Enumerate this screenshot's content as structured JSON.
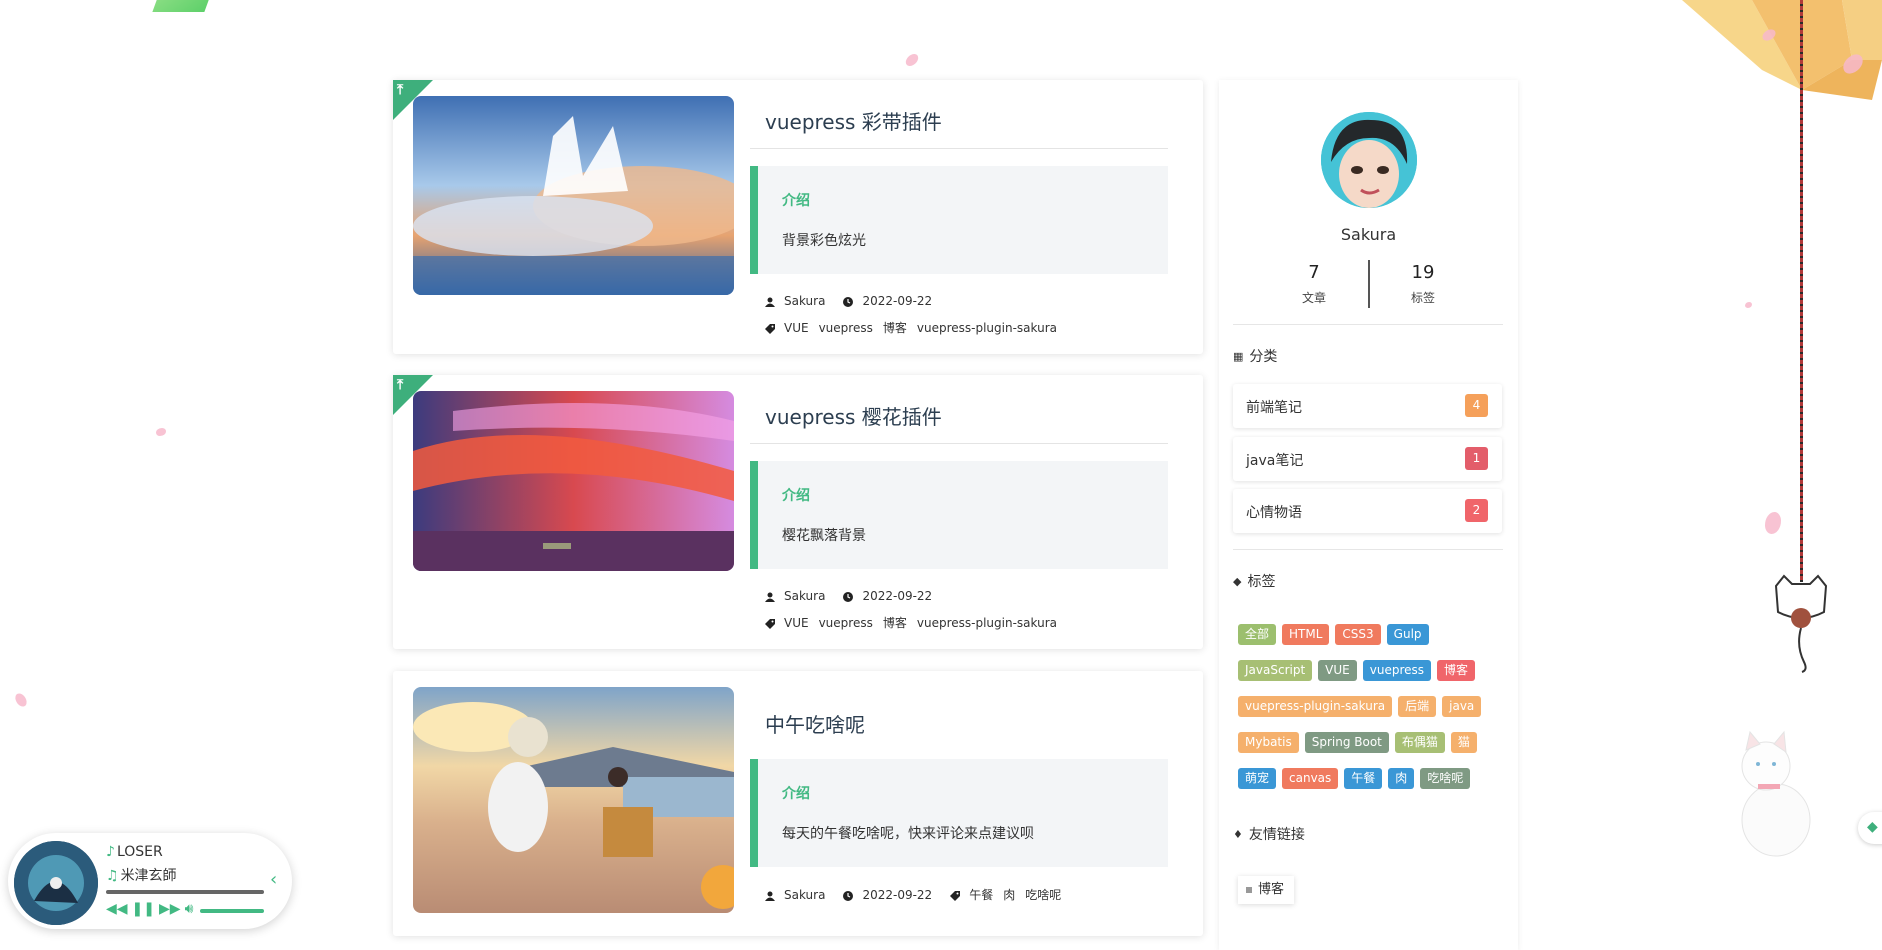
{
  "posts": [
    {
      "title": "vuepress 彩带插件",
      "excerpt_heading": "介绍",
      "excerpt_text": "背景彩色炫光",
      "author": "Sakura",
      "date": "2022-09-22",
      "tags": [
        "VUE",
        "vuepress",
        "博客",
        "vuepress-plugin-sakura"
      ],
      "sticky": true
    },
    {
      "title": "vuepress 樱花插件",
      "excerpt_heading": "介绍",
      "excerpt_text": "樱花飘落背景",
      "author": "Sakura",
      "date": "2022-09-22",
      "tags": [
        "VUE",
        "vuepress",
        "博客",
        "vuepress-plugin-sakura"
      ],
      "sticky": true
    },
    {
      "title": "中午吃啥呢",
      "excerpt_heading": "介绍",
      "excerpt_text": "每天的午餐吃啥呢，快来评论来点建议呗",
      "author": "Sakura",
      "date": "2022-09-22",
      "tags": [
        "午餐",
        "肉",
        "吃啥呢"
      ],
      "sticky": false
    }
  ],
  "profile": {
    "name": "Sakura",
    "articles_count": "7",
    "articles_label": "文章",
    "tags_count": "19",
    "tags_label": "标签"
  },
  "categories": {
    "title": "分类",
    "items": [
      {
        "name": "前端笔记",
        "count": "4",
        "color": "#f5a05a"
      },
      {
        "name": "java笔记",
        "count": "1",
        "color": "#e35d6a"
      },
      {
        "name": "心情物语",
        "count": "2",
        "color": "#f0656a"
      }
    ]
  },
  "tags": {
    "title": "标签",
    "items": [
      {
        "label": "全部",
        "color": "#9cbf6e"
      },
      {
        "label": "HTML",
        "color": "#f07a5e"
      },
      {
        "label": "CSS3",
        "color": "#f07a5e"
      },
      {
        "label": "Gulp",
        "color": "#3a97d6"
      },
      {
        "label": "JavaScript",
        "color": "#a7bf74"
      },
      {
        "label": "VUE",
        "color": "#7f9a83"
      },
      {
        "label": "vuepress",
        "color": "#3a97d6"
      },
      {
        "label": "博客",
        "color": "#f0656a"
      },
      {
        "label": "vuepress-plugin-sakura",
        "color": "#f5b06c"
      },
      {
        "label": "后端",
        "color": "#f5b06c"
      },
      {
        "label": "java",
        "color": "#f5b06c"
      },
      {
        "label": "Mybatis",
        "color": "#f5b06c"
      },
      {
        "label": "Spring Boot",
        "color": "#7f9a83"
      },
      {
        "label": "布偶猫",
        "color": "#a7bf74"
      },
      {
        "label": "猫",
        "color": "#f5b06c"
      },
      {
        "label": "萌宠",
        "color": "#3a97d6"
      },
      {
        "label": "canvas",
        "color": "#f07a5e"
      },
      {
        "label": "午餐",
        "color": "#3a97d6"
      },
      {
        "label": "肉",
        "color": "#3a97d6"
      },
      {
        "label": "吃啥呢",
        "color": "#7f9a83"
      }
    ]
  },
  "friends": {
    "title": "友情链接",
    "items": [
      {
        "label": "博客"
      }
    ]
  },
  "player": {
    "song": "LOSER",
    "artist": "米津玄師"
  },
  "accent_color": "#42b983"
}
